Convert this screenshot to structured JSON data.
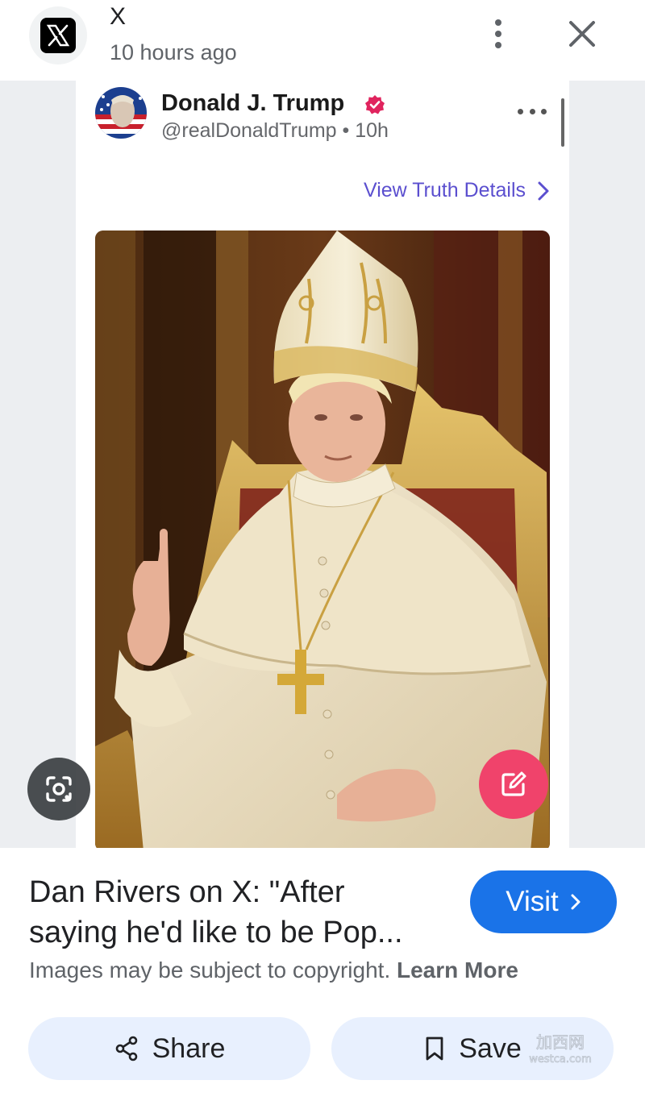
{
  "header": {
    "source_name": "X",
    "time_ago": "10 hours ago",
    "source_icon": "x-logo-icon",
    "more_icon": "more-vert-icon",
    "close_icon": "close-icon"
  },
  "post": {
    "author_name": "Donald J. Trump",
    "handle_time": "@realDonaldTrump • 10h",
    "verified_icon": "verified-badge-icon",
    "verified_color": "#e0245e",
    "view_details": "View Truth Details",
    "view_details_color": "#5b4fcf"
  },
  "overlay": {
    "lens_icon": "google-lens-icon",
    "edit_icon": "edit-icon",
    "edit_color": "#f0436b"
  },
  "result": {
    "title_line1": "Dan Rivers on X: \"After",
    "title_line2": "saying he'd like to be Pop...",
    "visit_label": "Visit",
    "visit_color": "#1a73e8",
    "copyright_text": "Images may be subject to copyright.",
    "learn_more": "Learn More"
  },
  "actions": {
    "share_label": "Share",
    "save_label": "Save",
    "share_icon": "share-icon",
    "save_icon": "bookmark-icon"
  },
  "watermark": {
    "line1": "加西网",
    "line2": "westca.com"
  }
}
